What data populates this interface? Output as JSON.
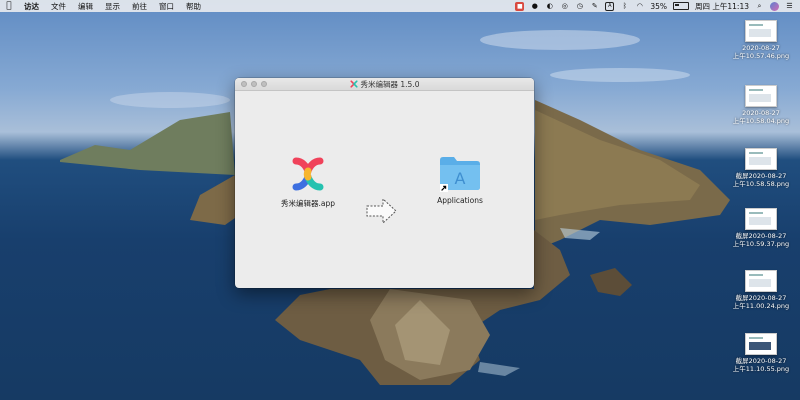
{
  "menubar": {
    "app_name": "访达",
    "items": [
      "文件",
      "编辑",
      "显示",
      "前往",
      "窗口",
      "帮助"
    ],
    "battery_percent": "35%",
    "clock": "周四 上午11:13"
  },
  "window": {
    "title": "秀米编辑器 1.5.0",
    "app_label": "秀米编辑器.app",
    "folder_label": "Applications"
  },
  "desktop_files": [
    {
      "date": "2020-08-27",
      "time": "上午10.57.46.png",
      "prefix": ""
    },
    {
      "date": "2020-08-27",
      "time": "上午10.58.04.png",
      "prefix": ""
    },
    {
      "date": "2020-08-27",
      "time": "上午10.58.58.png",
      "prefix": "截屏"
    },
    {
      "date": "2020-08-27",
      "time": "上午10.59.37.png",
      "prefix": "截屏"
    },
    {
      "date": "2020-08-27",
      "time": "上午11.00.24.png",
      "prefix": "截屏"
    },
    {
      "date": "2020-08-27",
      "time": "上午11.10.55.png",
      "prefix": "截屏"
    }
  ],
  "colors": {
    "folder": "#5aaee8",
    "logo_red": "#f0425a",
    "logo_teal": "#25c2b0",
    "logo_yellow": "#f7b52e",
    "logo_blue": "#3d6fe0"
  }
}
